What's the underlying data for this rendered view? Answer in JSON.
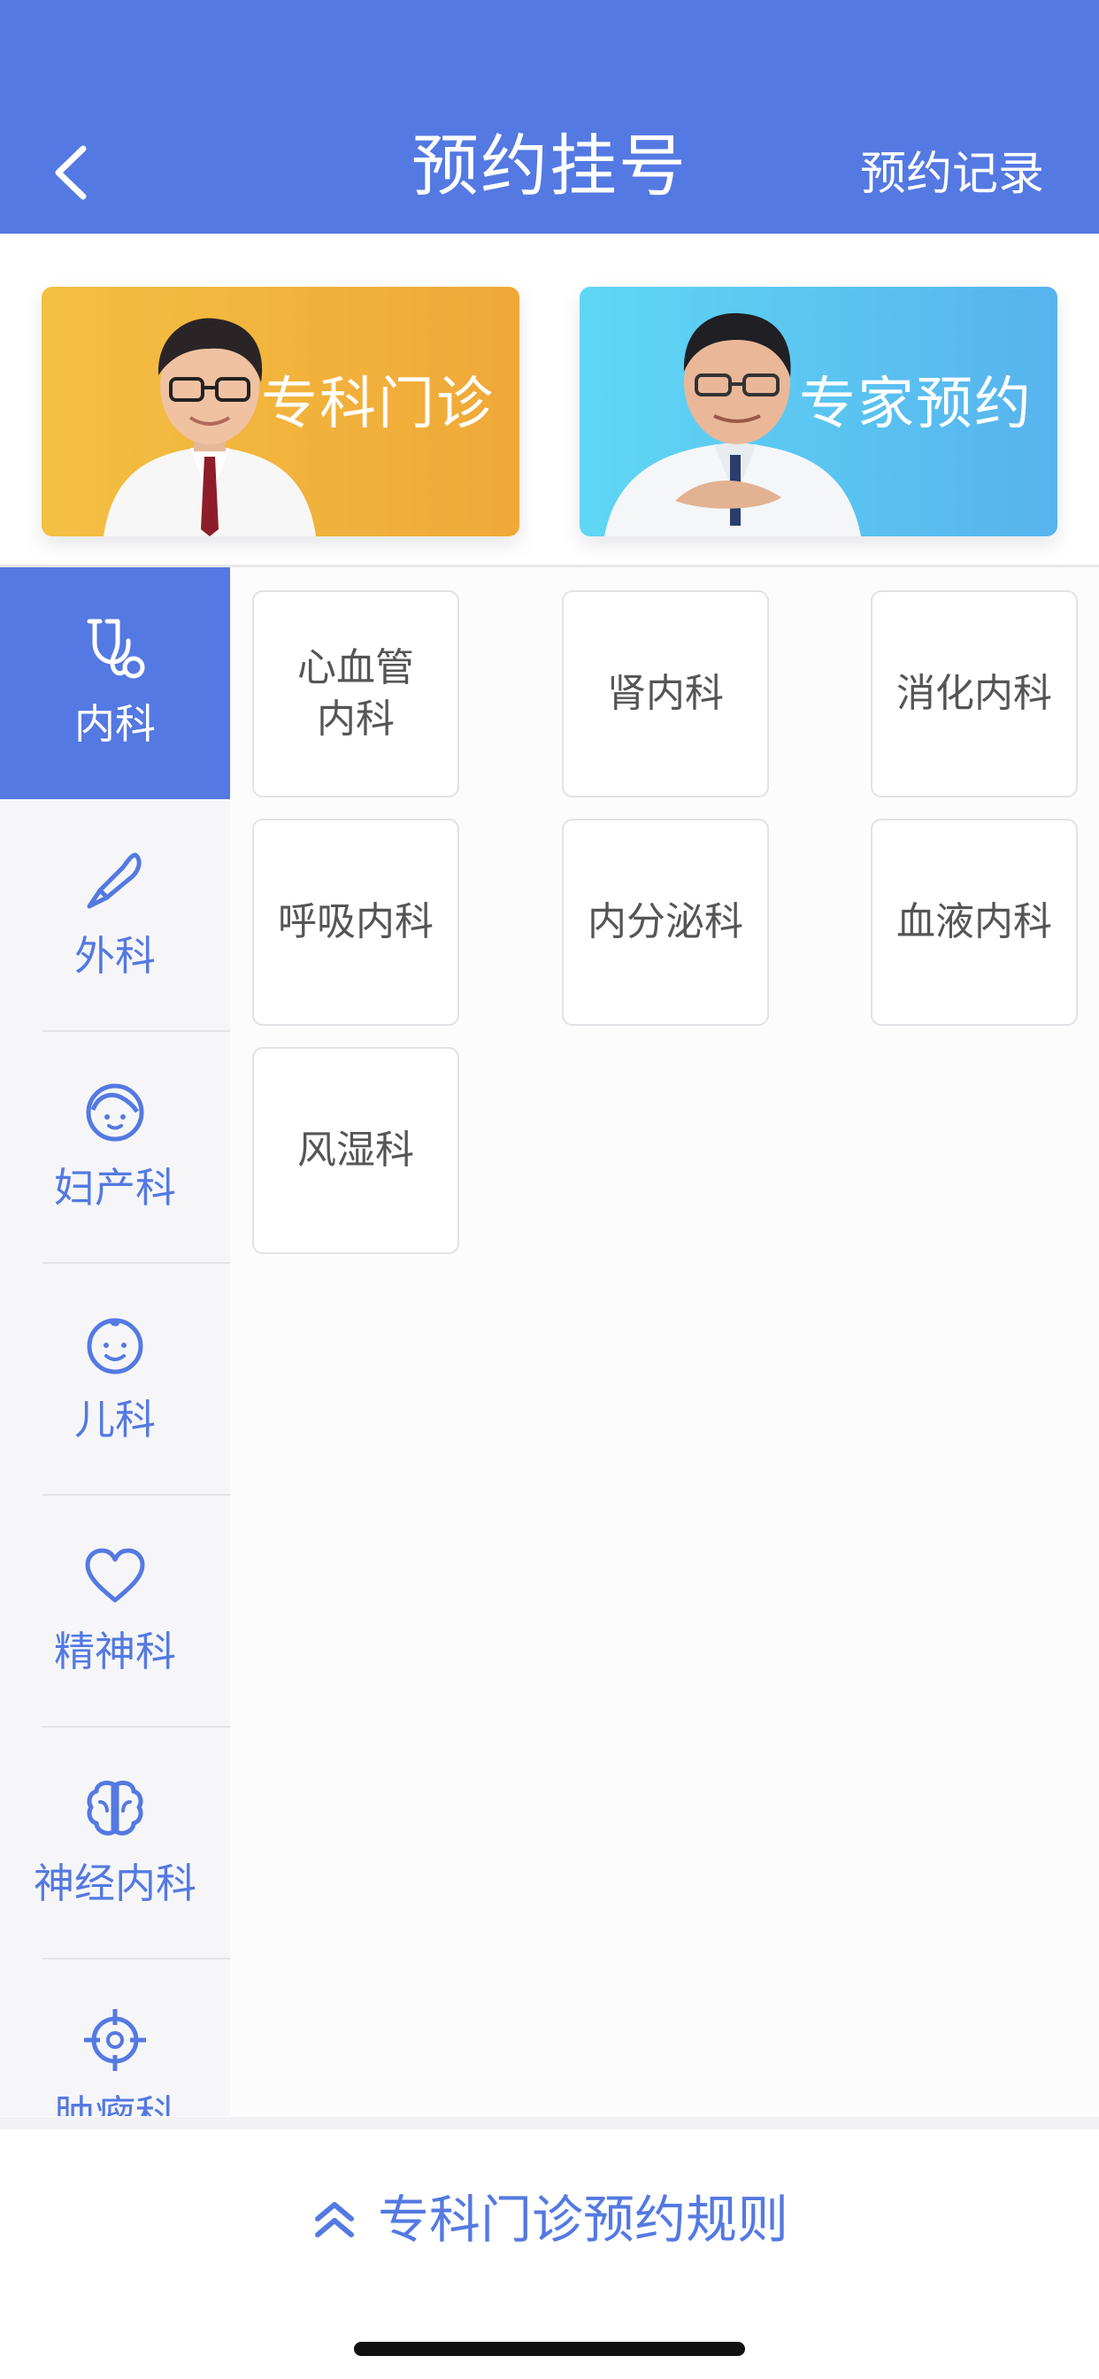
{
  "header": {
    "title": "预约挂号",
    "record_link": "预约记录",
    "back_icon": "chevron-left-icon",
    "color": "#5479e2"
  },
  "banners": [
    {
      "label": "专科门诊",
      "icon": "doctor-photo"
    },
    {
      "label": "专家预约",
      "icon": "doctor-photo"
    }
  ],
  "sidebar": {
    "items": [
      {
        "label": "内科",
        "icon": "stethoscope-icon",
        "active": true
      },
      {
        "label": "外科",
        "icon": "scalpel-icon",
        "active": false
      },
      {
        "label": "妇产科",
        "icon": "woman-face-icon",
        "active": false
      },
      {
        "label": "儿科",
        "icon": "baby-face-icon",
        "active": false
      },
      {
        "label": "精神科",
        "icon": "heart-icon",
        "active": false
      },
      {
        "label": "神经内科",
        "icon": "brain-icon",
        "active": false
      },
      {
        "label": "肿瘤科",
        "icon": "tumor-target-icon",
        "active": false
      }
    ]
  },
  "departments": [
    {
      "label": "心血管\n内科"
    },
    {
      "label": "肾内科"
    },
    {
      "label": "消化内科"
    },
    {
      "label": "呼吸内科"
    },
    {
      "label": "内分泌科"
    },
    {
      "label": "血液内科"
    },
    {
      "label": "风湿科"
    }
  ],
  "footer": {
    "rules_label": "专科门诊预约规则",
    "rules_icon": "double-chevron-up-icon"
  }
}
